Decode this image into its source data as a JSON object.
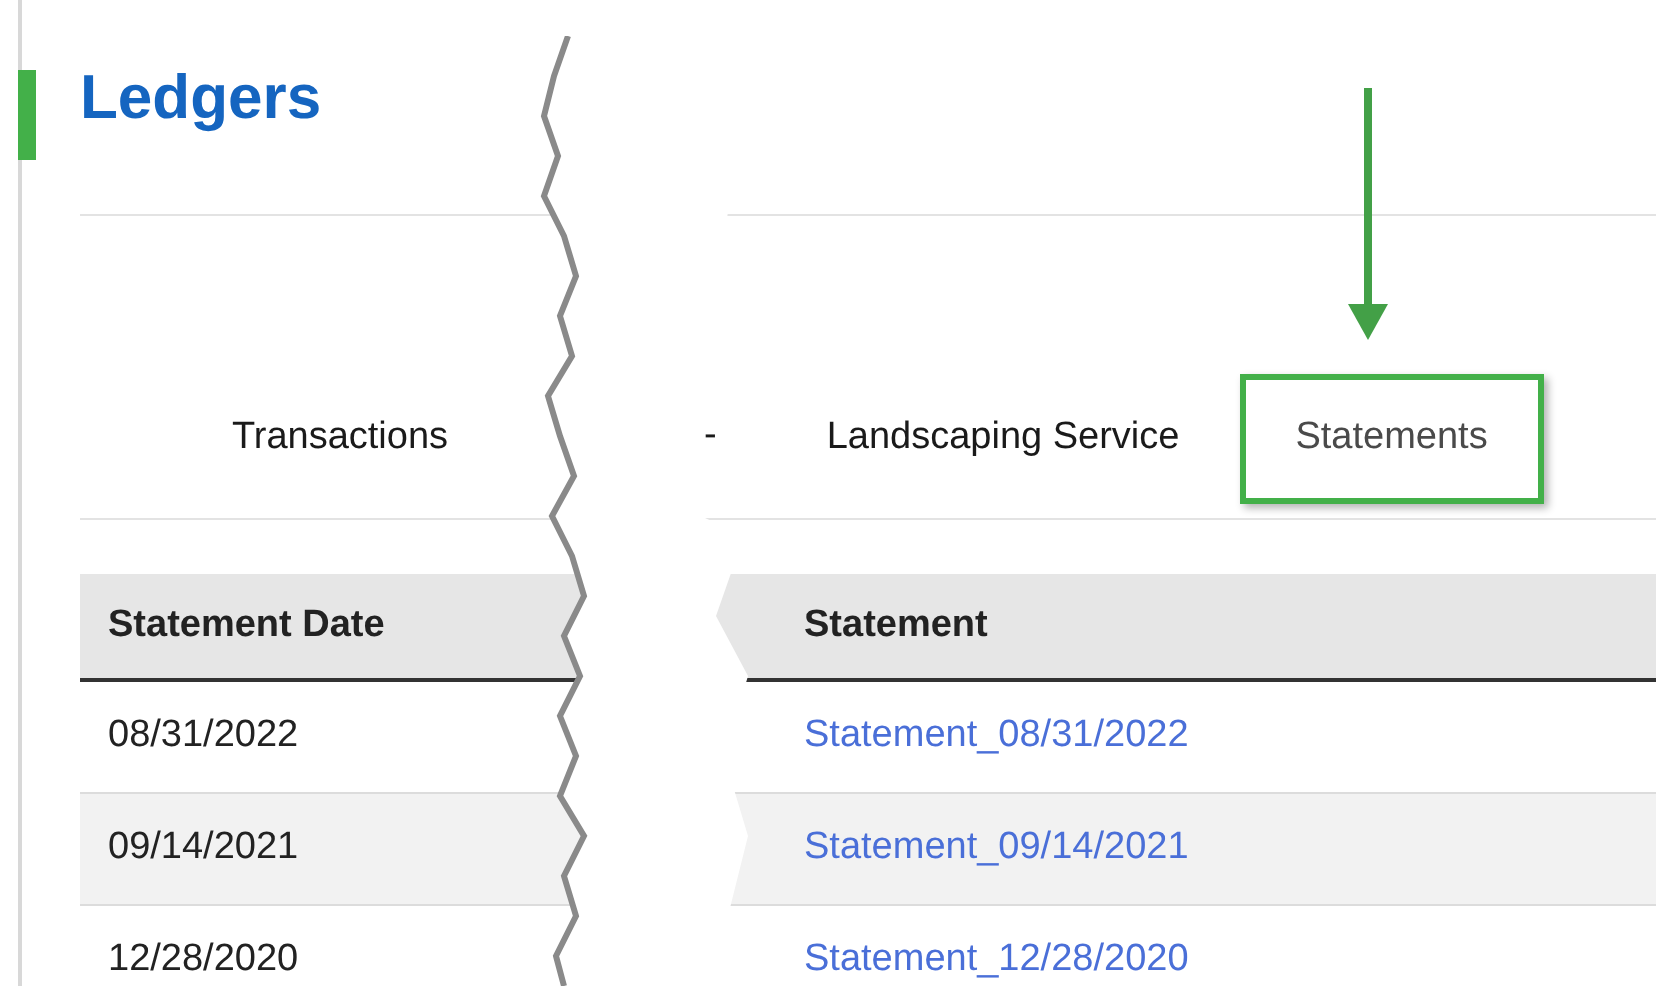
{
  "page_title": "Ledgers",
  "tab_separator": "-",
  "tabs": [
    {
      "label": "Transactions",
      "selected": false,
      "highlighted": false
    },
    {
      "label": "Landscaping Service",
      "selected": false,
      "highlighted": false
    },
    {
      "label": "Statements",
      "selected": true,
      "highlighted": true
    }
  ],
  "table": {
    "columns": [
      "Statement Date",
      "Statement"
    ],
    "rows": [
      {
        "date": "08/31/2022",
        "statement": "Statement_08/31/2022"
      },
      {
        "date": "09/14/2021",
        "statement": "Statement_09/14/2021"
      },
      {
        "date": "12/28/2020",
        "statement": "Statement_12/28/2020"
      }
    ]
  }
}
